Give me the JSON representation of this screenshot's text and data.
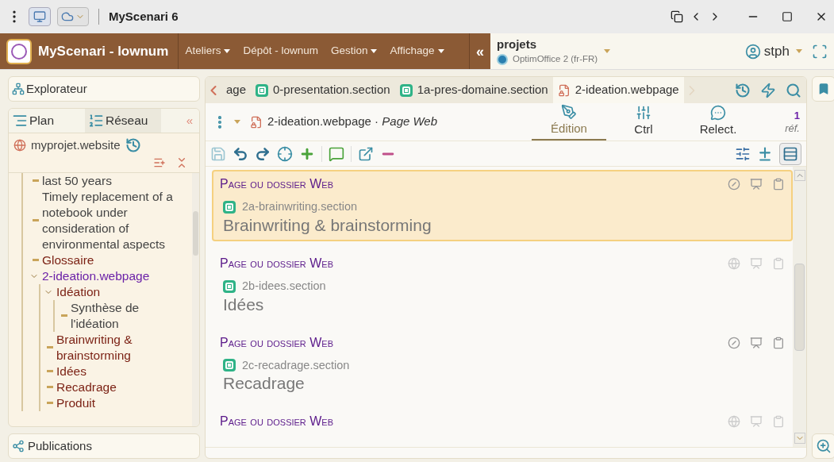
{
  "window": {
    "title": "MyScenari 6"
  },
  "menu_bar": {
    "app_name": "MyScenari - lownum",
    "items": [
      {
        "label": "Ateliers",
        "dropdown": true
      },
      {
        "label": "Dépôt - lownum",
        "dropdown": false
      },
      {
        "label": "Gestion",
        "dropdown": true
      },
      {
        "label": "Affichage",
        "dropdown": true
      }
    ],
    "collapse": "«",
    "project": {
      "title": "projets",
      "subtitle": "OptimOffice 2 (fr-FR)"
    },
    "user": "stph"
  },
  "explorer": {
    "title": "Explorateur"
  },
  "tree_panel": {
    "tabs": [
      {
        "label": "Plan",
        "selected": false
      },
      {
        "label": "Réseau",
        "selected": true
      }
    ],
    "collapse": "«",
    "root": "myprojet.website",
    "items": [
      {
        "label": "last 50 years",
        "kind": "page",
        "selected": false
      },
      {
        "label": "Timely replacement of a notebook under consideration of environmental aspects",
        "kind": "page",
        "selected": false
      },
      {
        "label": "Glossaire",
        "kind": "section",
        "selected": false
      },
      {
        "label": "2-ideation.webpage",
        "selected": true,
        "expanded": true,
        "children": [
          {
            "label": "Idéation",
            "kind": "section",
            "selected": false,
            "expanded": true,
            "children": [
              {
                "label": "Synthèse de l'idéation",
                "kind": "page",
                "selected": false
              }
            ]
          },
          {
            "label": "Brainwriting & brainstorming",
            "kind": "section",
            "selected": false
          },
          {
            "label": "Idées",
            "kind": "section",
            "selected": false
          },
          {
            "label": "Recadrage",
            "kind": "section",
            "selected": false
          },
          {
            "label": "Produit",
            "kind": "section",
            "selected": false
          }
        ]
      }
    ]
  },
  "publications": {
    "title": "Publications"
  },
  "editor": {
    "tabs": [
      {
        "label": "age",
        "kind": "cut",
        "selected": false
      },
      {
        "label": "0-presentation.section",
        "kind": "section",
        "selected": false
      },
      {
        "label": "1a-pres-domaine.section",
        "kind": "section",
        "selected": false
      },
      {
        "label": "2-ideation.webpage",
        "kind": "webpage",
        "selected": true
      }
    ],
    "header": {
      "name": "2-ideation.webpage",
      "separator": "·",
      "type": "Page Web"
    },
    "modes": [
      {
        "label": "Édition",
        "kind": "edit",
        "selected": true
      },
      {
        "label": "Ctrl",
        "kind": "ctrl",
        "selected": false
      },
      {
        "label": "Relect.",
        "kind": "review",
        "selected": false
      }
    ],
    "refs": {
      "count": "1",
      "label": "réf."
    },
    "blocks": [
      {
        "heading": "Page ou dossier Web",
        "file": "2a-brainwriting.section",
        "title": "Brainwriting & brainstorming",
        "selected": true,
        "hidden_online": true
      },
      {
        "heading": "Page ou dossier Web",
        "file": "2b-idees.section",
        "title": "Idées",
        "selected": false,
        "hidden_online": false
      },
      {
        "heading": "Page ou dossier Web",
        "file": "2c-recadrage.section",
        "title": "Recadrage",
        "selected": false,
        "hidden_online": true
      },
      {
        "heading": "Page ou dossier Web",
        "selected": false,
        "hidden_online": false
      }
    ]
  }
}
